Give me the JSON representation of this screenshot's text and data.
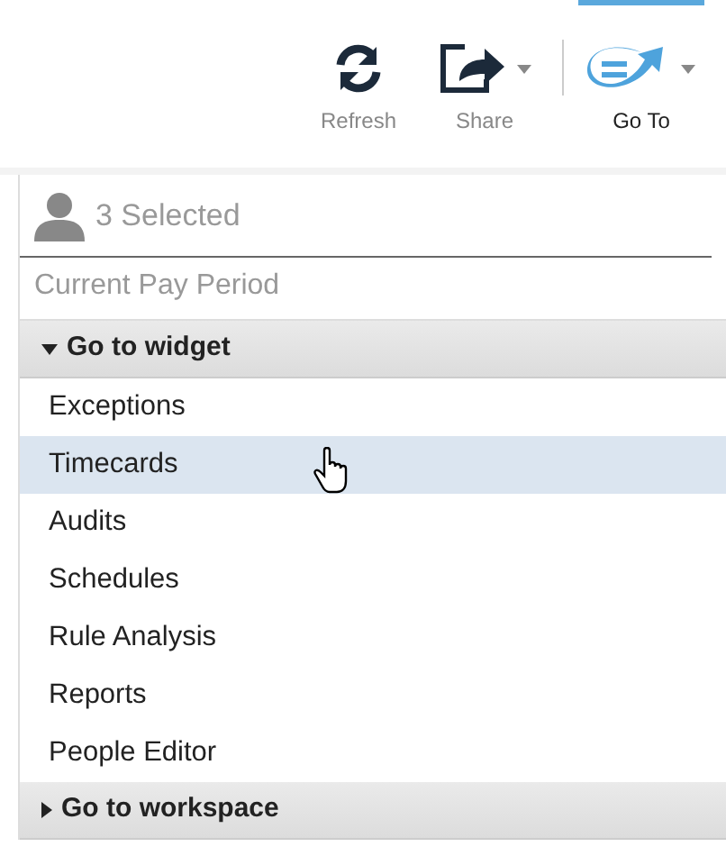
{
  "toolbar": [
    {
      "kind": "refresh",
      "label": "Refresh",
      "dropdown": false,
      "selected": false
    },
    {
      "kind": "share",
      "label": "Share",
      "dropdown": true,
      "selected": false
    },
    {
      "kind": "goto",
      "label": "Go To",
      "dropdown": true,
      "selected": true
    }
  ],
  "panel": {
    "selection": "3 Selected",
    "period": "Current Pay Period",
    "sections": [
      {
        "title": "Go to widget",
        "expanded": true,
        "items": [
          {
            "label": "Exceptions",
            "selected": false
          },
          {
            "label": "Timecards",
            "selected": true
          },
          {
            "label": "Audits",
            "selected": false
          },
          {
            "label": "Schedules",
            "selected": false
          },
          {
            "label": "Rule Analysis",
            "selected": false
          },
          {
            "label": "Reports",
            "selected": false
          },
          {
            "label": "People Editor",
            "selected": false
          }
        ]
      },
      {
        "title": "Go to workspace",
        "expanded": false
      }
    ]
  }
}
